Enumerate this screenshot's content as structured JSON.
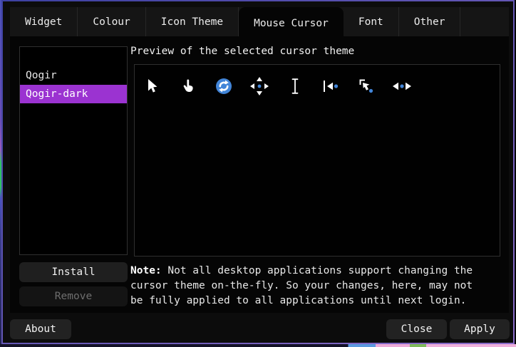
{
  "tabs": [
    {
      "label": "Widget",
      "active": false
    },
    {
      "label": "Colour",
      "active": false
    },
    {
      "label": "Icon Theme",
      "active": false
    },
    {
      "label": "Mouse Cursor",
      "active": true
    },
    {
      "label": "Font",
      "active": false
    },
    {
      "label": "Other",
      "active": false
    }
  ],
  "cursor_theme_list": {
    "items": [
      {
        "label": "Qogir",
        "selected": false
      },
      {
        "label": "Qogir-dark",
        "selected": true
      }
    ]
  },
  "preview": {
    "label": "Preview of the selected cursor theme",
    "cursors": [
      "left-pointer-cursor-icon",
      "hand-cursor-icon",
      "busy-spinner-cursor-icon",
      "move-cursor-icon",
      "text-ibeam-cursor-icon",
      "left-edge-cursor-icon",
      "top-left-corner-resize-cursor-icon",
      "horizontal-resize-cursor-icon"
    ]
  },
  "buttons": {
    "install": "Install",
    "remove": "Remove",
    "about": "About",
    "close": "Close",
    "apply": "Apply"
  },
  "note": {
    "prefix": "Note:",
    "line1_rest": " Not all desktop applications support changing the",
    "line2": "cursor theme on-the-fly. So your changes, here, may not",
    "line3": "be fully applied to all applications until next login."
  },
  "colors": {
    "selection_purple": "#9b33d1",
    "cursor_accent_blue": "#4285d8",
    "window_border_blue": "#4044a8",
    "window_border_purple": "#8a6cc8"
  }
}
